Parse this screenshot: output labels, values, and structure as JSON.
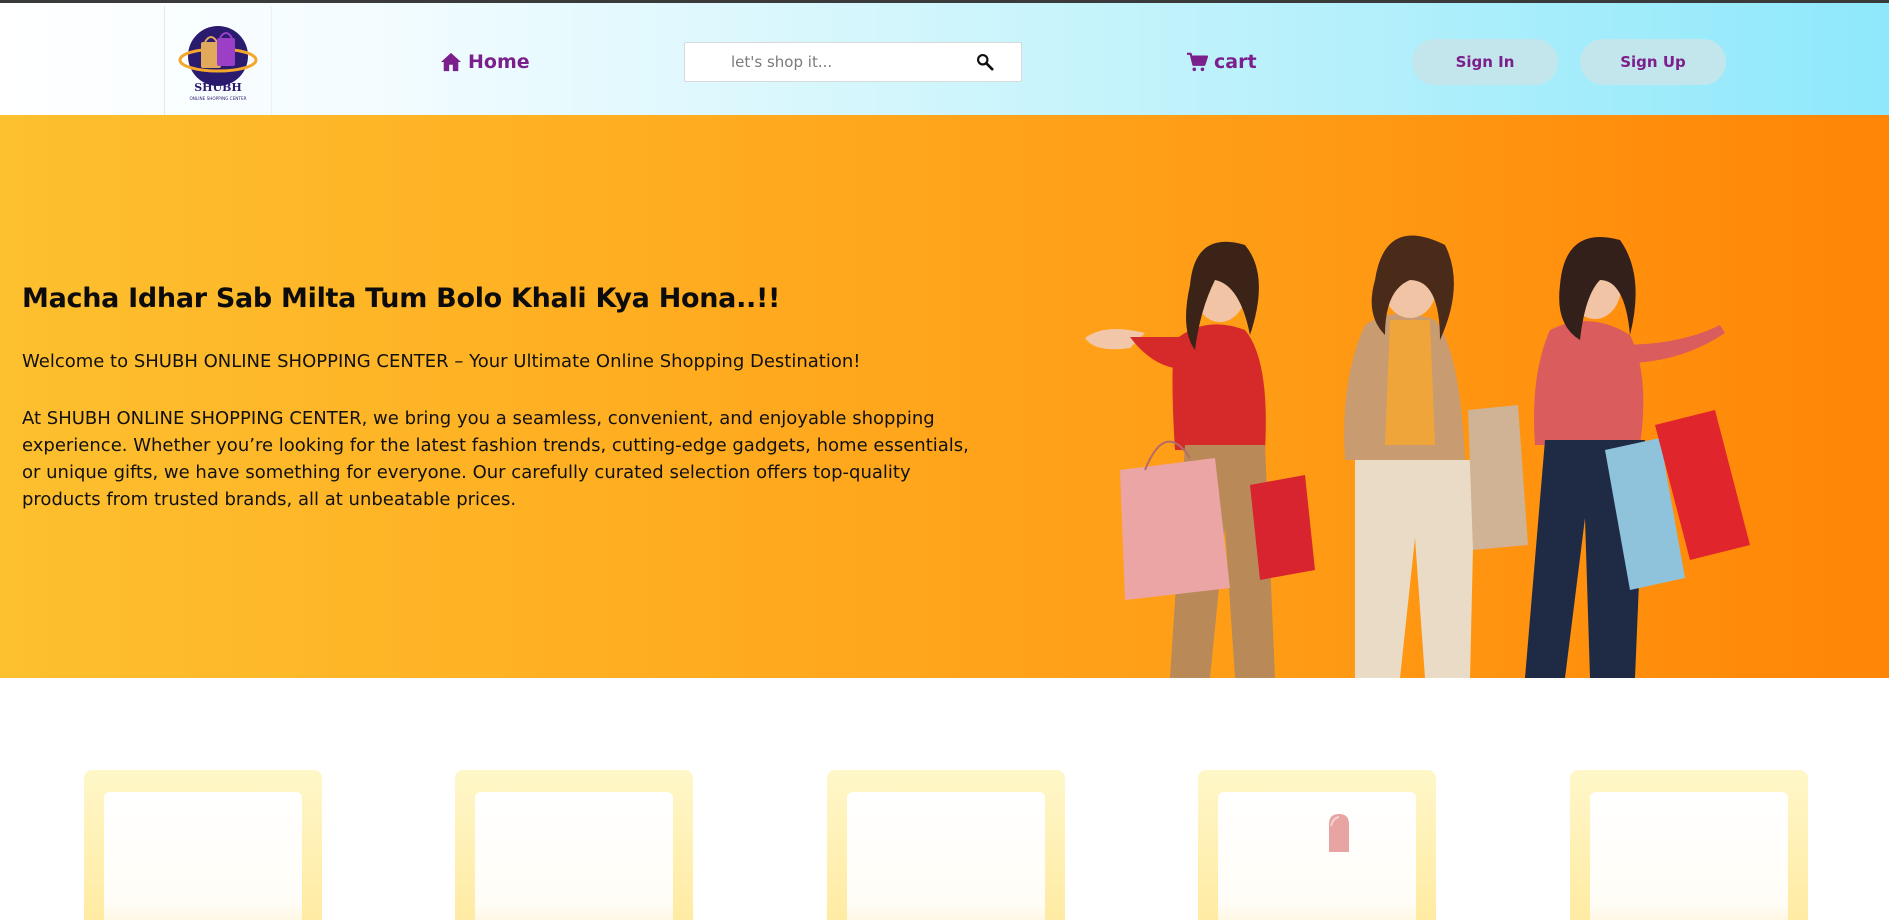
{
  "header": {
    "logo": {
      "icon": "shopping-bags-globe-logo",
      "brand_text": "SHUBH",
      "tagline": "ONLINE SHOPPING CENTER"
    },
    "home_label": "Home",
    "search": {
      "placeholder": "let's shop it...",
      "value": ""
    },
    "cart_label": "cart",
    "signin_label": "Sign In",
    "signup_label": "Sign Up",
    "colors": {
      "accent": "#7b1f8c",
      "button_bg": "#c3e6ec"
    }
  },
  "hero": {
    "title": "Macha Idhar Sab Milta Tum Bolo Khali Kya Hona..!!",
    "welcome": "Welcome to SHUBH ONLINE SHOPPING CENTER – Your Ultimate Online Shopping Destination!",
    "description": "At SHUBH ONLINE SHOPPING CENTER, we bring you a seamless, convenient, and enjoyable shopping experience. Whether you’re looking for the latest fashion trends, cutting-edge gadgets, home essentials, or unique gifts, we have something for everyone. Our carefully curated selection offers top-quality products from trusted brands, all at unbeatable prices.",
    "image": "three-women-with-shopping-bags",
    "colors": {
      "gradient_start": "#fdc02f",
      "gradient_end": "#ff8506"
    }
  },
  "products": {
    "cards": [
      {
        "image": "product-placeholder"
      },
      {
        "image": "product-placeholder"
      },
      {
        "image": "product-placeholder"
      },
      {
        "image": "lipstick-product"
      },
      {
        "image": "product-placeholder"
      }
    ]
  }
}
